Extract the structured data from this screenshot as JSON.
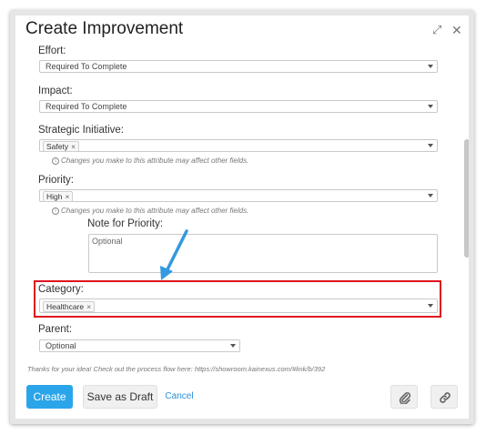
{
  "dialog": {
    "title": "Create Improvement",
    "expand_icon": "expand-icon",
    "close_icon": "close-icon"
  },
  "fields": {
    "effort": {
      "label": "Effort:",
      "value": "Required To Complete"
    },
    "impact": {
      "label": "Impact:",
      "value": "Required To Complete"
    },
    "strategic": {
      "label": "Strategic Initiative:",
      "tag": "Safety",
      "note": "Changes you make to this attribute may affect other fields."
    },
    "priority": {
      "label": "Priority:",
      "tag": "High",
      "note": "Changes you make to this attribute may affect other fields."
    },
    "priority_note": {
      "label": "Note for Priority:",
      "placeholder": "Optional"
    },
    "category": {
      "label": "Category:",
      "tag": "Healthcare"
    },
    "parent": {
      "label": "Parent:",
      "value": "Optional"
    }
  },
  "tag_remove": "×",
  "footer": {
    "thanks": "Thanks for your idea! Check out the process flow here: https://showroom.kainexus.com/#link/b/392",
    "create": "Create",
    "save_draft": "Save as Draft",
    "cancel": "Cancel",
    "attach_icon": "paperclip-icon",
    "link_icon": "link-icon"
  },
  "colors": {
    "primary": "#2aa5ea",
    "highlight": "#e0141e",
    "arrow": "#3399e0"
  }
}
